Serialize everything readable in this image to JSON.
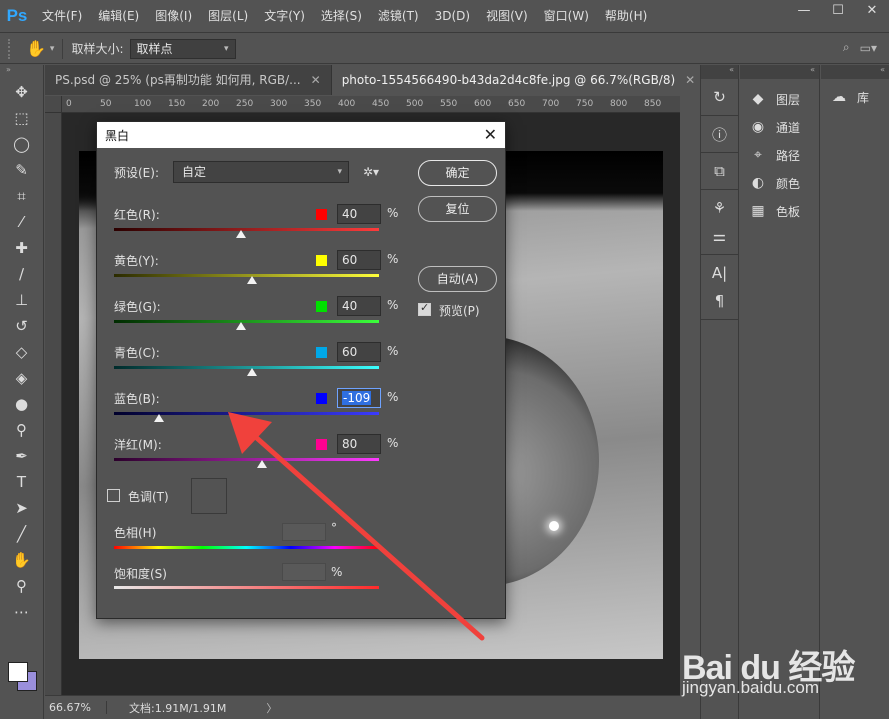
{
  "app": {
    "logo": "Ps"
  },
  "menu": [
    "文件(F)",
    "编辑(E)",
    "图像(I)",
    "图层(L)",
    "文字(Y)",
    "选择(S)",
    "滤镜(T)",
    "3D(D)",
    "视图(V)",
    "窗口(W)",
    "帮助(H)"
  ],
  "window_controls": {
    "minimize": "—",
    "maximize": "☐",
    "close": "✕"
  },
  "options": {
    "sample_size_label": "取样大小:",
    "sample_size_value": "取样点"
  },
  "tabs": [
    {
      "label": "PS.psd @ 25% (ps再制功能 如何用, RGB/...",
      "close": "✕"
    },
    {
      "label": "photo-1554566490-b43da2d4c8fe.jpg @ 66.7%(RGB/8)",
      "close": "✕"
    }
  ],
  "ruler_ticks": [
    "0",
    "50",
    "100",
    "150",
    "200",
    "250",
    "300",
    "350",
    "400",
    "450",
    "500",
    "550",
    "600",
    "650",
    "700",
    "750",
    "800",
    "850"
  ],
  "status": {
    "zoom": "66.67%",
    "doc": "文档:1.91M/1.91M",
    "arrow": "〉"
  },
  "panels": [
    {
      "label": "图层",
      "icon": "layers-icon"
    },
    {
      "label": "通道",
      "icon": "channels-icon"
    },
    {
      "label": "路径",
      "icon": "paths-icon"
    },
    {
      "label": "颜色",
      "icon": "color-icon"
    },
    {
      "label": "色板",
      "icon": "swatches-icon"
    }
  ],
  "library": {
    "label": "库"
  },
  "dialog": {
    "title": "黑白",
    "close": "✕",
    "preset_label": "预设(E):",
    "preset_value": "自定",
    "ok": "确定",
    "reset": "复位",
    "auto": "自动(A)",
    "preview_label": "预览(P)",
    "preview_checked": true,
    "sliders": [
      {
        "name": "红色(R):",
        "value": "40",
        "chip": "#ff0000",
        "gradient": "linear-gradient(90deg,#2b0000,#ff3b3b)"
      },
      {
        "name": "黄色(Y):",
        "value": "60",
        "chip": "#ffff00",
        "gradient": "linear-gradient(90deg,#2b2b00,#ffff3b)"
      },
      {
        "name": "绿色(G):",
        "value": "40",
        "chip": "#00e000",
        "gradient": "linear-gradient(90deg,#002b00,#3bff3b)"
      },
      {
        "name": "青色(C):",
        "value": "60",
        "chip": "#00a8e8",
        "gradient": "linear-gradient(90deg,#002b2b,#3bffff)"
      },
      {
        "name": "蓝色(B):",
        "value": "-109",
        "chip": "#0000ff",
        "gradient": "linear-gradient(90deg,#00002b,#3b3bff)",
        "selected": true
      },
      {
        "name": "洋红(M):",
        "value": "80",
        "chip": "#ff0090",
        "gradient": "linear-gradient(90deg,#2b002b,#ff3bff)"
      }
    ],
    "slider_positions": [
      0.48,
      0.52,
      0.48,
      0.52,
      0.17,
      0.56
    ],
    "tint_label": "色调(T)",
    "hue_label": "色相(H)",
    "hue_unit": "°",
    "saturation_label": "饱和度(S)",
    "saturation_unit": "%",
    "pct": "%"
  },
  "watermark": {
    "line1": "Bai du 经验",
    "line2": "jingyan.baidu.com"
  },
  "colors": {
    "accent": "#31a8ff",
    "arrow": "#f0413c"
  }
}
